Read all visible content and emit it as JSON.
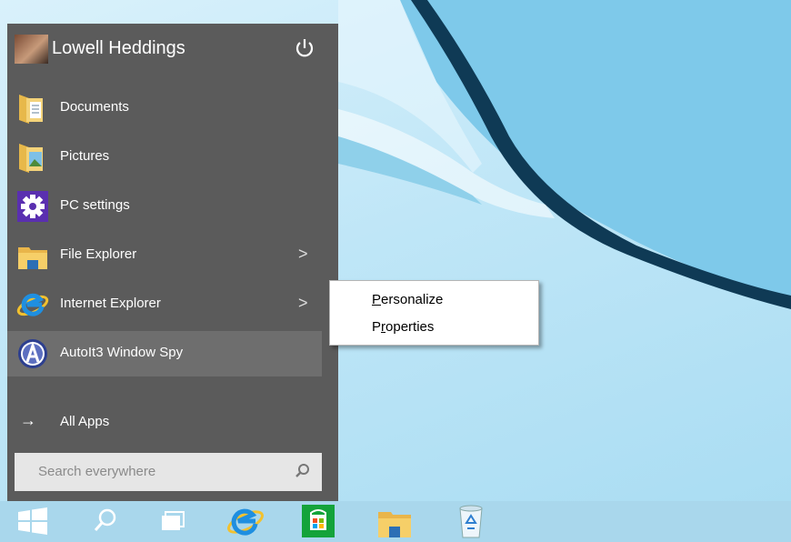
{
  "start_menu": {
    "user_name": "Lowell Heddings",
    "items": [
      {
        "label": "Documents",
        "icon": "documents-folder-icon"
      },
      {
        "label": "Pictures",
        "icon": "pictures-folder-icon"
      },
      {
        "label": "PC settings",
        "icon": "gear-icon"
      },
      {
        "label": "File Explorer",
        "icon": "file-explorer-icon",
        "chevron": ">"
      },
      {
        "label": "Internet Explorer",
        "icon": "internet-explorer-icon",
        "chevron": ">"
      },
      {
        "label": "AutoIt3 Window Spy",
        "icon": "autoit-icon"
      }
    ],
    "all_apps_label": "All Apps",
    "all_apps_arrow": "→",
    "search_placeholder": "Search everywhere"
  },
  "context_menu": {
    "items": [
      {
        "mnemonic": "P",
        "rest": "ersonalize"
      },
      {
        "mnemonic": "",
        "prefix": "P",
        "underlined": "r",
        "rest": "operties"
      }
    ]
  },
  "taskbar": {
    "icons": [
      "windows-start-icon",
      "search-icon",
      "task-view-icon",
      "internet-explorer-icon",
      "store-icon",
      "file-explorer-icon",
      "recycle-bin-icon"
    ]
  },
  "colors": {
    "start_bg": "#5b5b5b",
    "selected_item": "#6e6e6e",
    "taskbar": "#a9d7ec",
    "settings_tile": "#5a2fb0",
    "store_tile": "#14a33a"
  }
}
